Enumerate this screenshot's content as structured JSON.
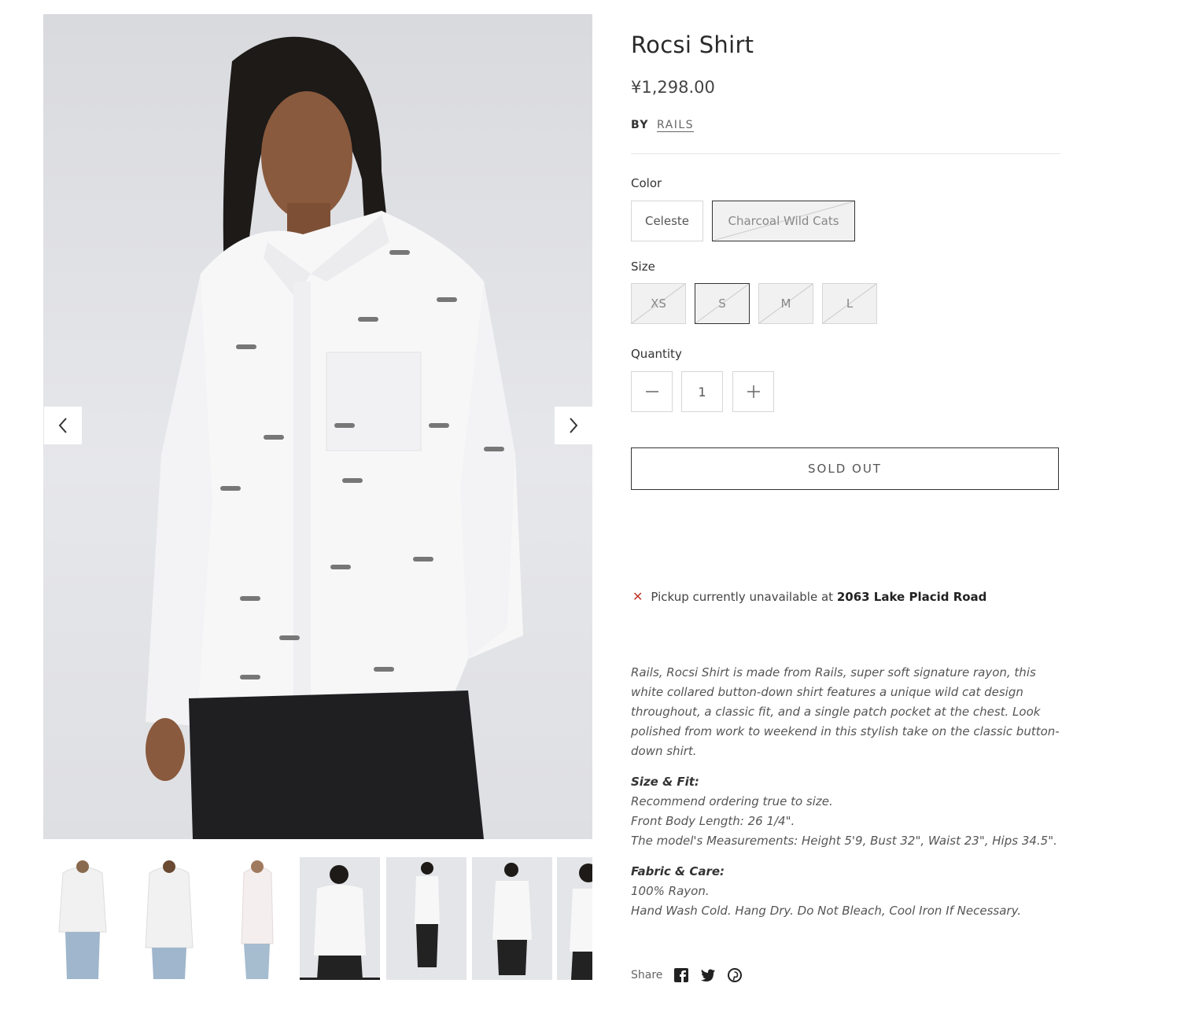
{
  "product": {
    "title": "Rocsi Shirt",
    "price": "¥1,298.00",
    "by_label": "BY",
    "vendor": "RAILS"
  },
  "color": {
    "label": "Color",
    "options": [
      {
        "label": "Celeste",
        "selected": false,
        "available": true
      },
      {
        "label": "Charcoal Wild Cats",
        "selected": true,
        "available": false
      }
    ]
  },
  "size": {
    "label": "Size",
    "options": [
      {
        "label": "XS",
        "selected": false,
        "available": false
      },
      {
        "label": "S",
        "selected": true,
        "available": false
      },
      {
        "label": "M",
        "selected": false,
        "available": false
      },
      {
        "label": "L",
        "selected": false,
        "available": false
      }
    ]
  },
  "quantity": {
    "label": "Quantity",
    "value": "1",
    "minus_icon": "minus-icon",
    "plus_icon": "plus-icon"
  },
  "buy_button": "SOLD OUT",
  "pickup": {
    "icon": "close-icon",
    "text": "Pickup currently unavailable at",
    "location": "2063 Lake Placid Road"
  },
  "description": {
    "intro": "Rails,  Rocsi Shirt is made from Rails, super soft signature rayon, this white collared button-down shirt features a unique wild cat design throughout, a classic fit, and a single patch pocket at the chest. Look polished from work to weekend in this stylish take on the classic button-down shirt.",
    "size_fit_heading": "Size & Fit:",
    "size_fit_lines": [
      "Recommend ordering true to size.",
      "Front Body Length: 26 1/4\".",
      "The model's Measurements: Height 5'9, Bust 32\", Waist 23\", Hips 34.5\"."
    ],
    "fabric_heading": "Fabric & Care:",
    "fabric_lines": [
      "100% Rayon.",
      "Hand Wash Cold. Hang Dry. Do Not Bleach, Cool Iron If Necessary."
    ]
  },
  "share": {
    "label": "Share",
    "icons": [
      "facebook-icon",
      "twitter-icon",
      "pinterest-icon"
    ]
  },
  "gallery": {
    "prev_icon": "chevron-left-icon",
    "next_icon": "chevron-right-icon",
    "thumbnail_count": 7,
    "active_thumbnail": 4
  },
  "colors": {
    "text": "#333333",
    "border": "#d6d6d6",
    "error": "#c0392b",
    "image_bg": "#dedfe2"
  }
}
